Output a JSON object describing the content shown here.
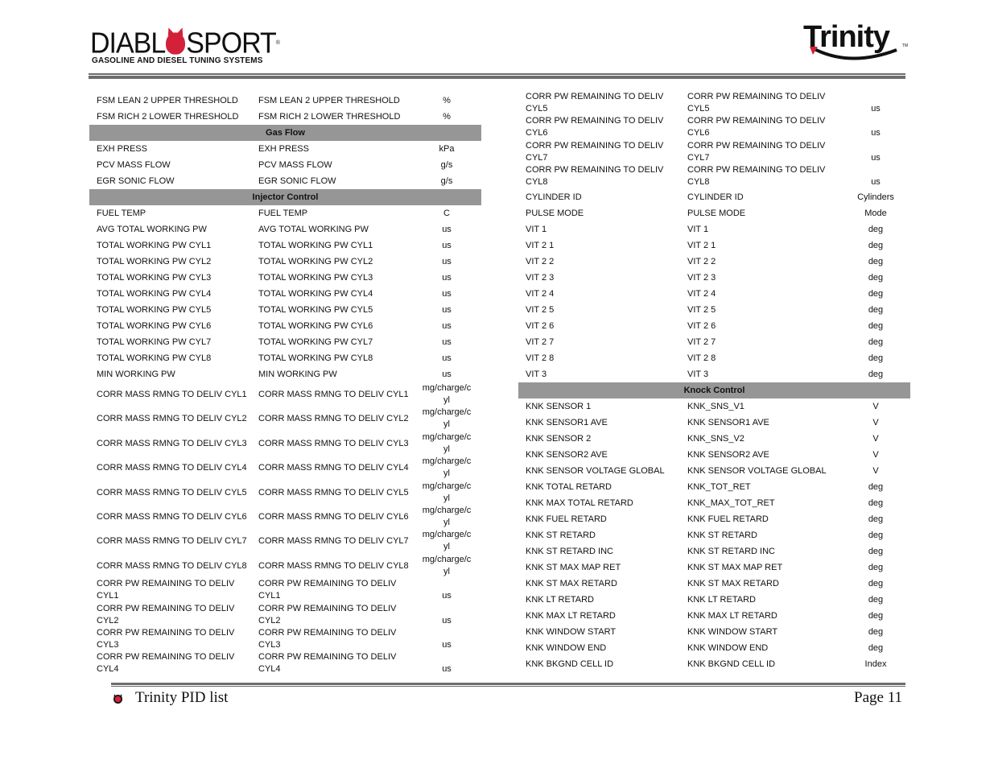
{
  "header": {
    "brand_left": "DIABLOSPORT",
    "brand_left_tagline": "GASOLINE AND DIESEL TUNING SYSTEMS",
    "brand_right": "Trinity",
    "brand_right_tm": "TM"
  },
  "colors": {
    "section_bg": "#969696",
    "rule": "#6d6d6d",
    "accent_red": "#d4213a"
  },
  "left_column": [
    {
      "type": "row",
      "name": "FSM LEAN 2 UPPER THRESHOLD",
      "pid": "FSM LEAN 2 UPPER THRESHOLD",
      "unit": "%"
    },
    {
      "type": "row",
      "name": "FSM RICH 2 LOWER THRESHOLD",
      "pid": "FSM RICH 2 LOWER THRESHOLD",
      "unit": "%"
    },
    {
      "type": "section",
      "title": "Gas Flow"
    },
    {
      "type": "row",
      "name": "EXH PRESS",
      "pid": "EXH PRESS",
      "unit": "kPa"
    },
    {
      "type": "row",
      "name": "PCV MASS FLOW",
      "pid": "PCV MASS FLOW",
      "unit": "g/s"
    },
    {
      "type": "row",
      "name": "EGR SONIC FLOW",
      "pid": "EGR SONIC FLOW",
      "unit": "g/s"
    },
    {
      "type": "section",
      "title": "Injector Control"
    },
    {
      "type": "row",
      "name": "FUEL TEMP",
      "pid": "FUEL TEMP",
      "unit": "C"
    },
    {
      "type": "row",
      "name": "AVG TOTAL WORKING PW",
      "pid": "AVG TOTAL WORKING PW",
      "unit": "us"
    },
    {
      "type": "row",
      "name": "TOTAL WORKING PW CYL1",
      "pid": "TOTAL WORKING PW CYL1",
      "unit": "us"
    },
    {
      "type": "row",
      "name": "TOTAL WORKING PW CYL2",
      "pid": "TOTAL WORKING PW CYL2",
      "unit": "us"
    },
    {
      "type": "row",
      "name": "TOTAL WORKING PW CYL3",
      "pid": "TOTAL WORKING PW CYL3",
      "unit": "us"
    },
    {
      "type": "row",
      "name": "TOTAL WORKING PW CYL4",
      "pid": "TOTAL WORKING PW CYL4",
      "unit": "us"
    },
    {
      "type": "row",
      "name": "TOTAL WORKING PW CYL5",
      "pid": "TOTAL WORKING PW CYL5",
      "unit": "us"
    },
    {
      "type": "row",
      "name": "TOTAL WORKING PW CYL6",
      "pid": "TOTAL WORKING PW CYL6",
      "unit": "us"
    },
    {
      "type": "row",
      "name": "TOTAL WORKING PW CYL7",
      "pid": "TOTAL WORKING PW CYL7",
      "unit": "us"
    },
    {
      "type": "row",
      "name": "TOTAL WORKING PW CYL8",
      "pid": "TOTAL WORKING PW CYL8",
      "unit": "us"
    },
    {
      "type": "row",
      "name": "MIN WORKING PW",
      "pid": "MIN WORKING PW",
      "unit": "us"
    },
    {
      "type": "unit2",
      "name": "CORR MASS RMNG TO DELIV CYL1",
      "pid": "CORR MASS RMNG TO DELIV CYL1",
      "unit": "mg/charge/c yl"
    },
    {
      "type": "unit2",
      "name": "CORR MASS RMNG TO DELIV CYL2",
      "pid": "CORR MASS RMNG TO DELIV CYL2",
      "unit": "mg/charge/c yl"
    },
    {
      "type": "unit2",
      "name": "CORR MASS RMNG TO DELIV CYL3",
      "pid": "CORR MASS RMNG TO DELIV CYL3",
      "unit": "mg/charge/c yl"
    },
    {
      "type": "unit2",
      "name": "CORR MASS RMNG TO DELIV CYL4",
      "pid": "CORR MASS RMNG TO DELIV CYL4",
      "unit": "mg/charge/c yl"
    },
    {
      "type": "unit2",
      "name": "CORR MASS RMNG TO DELIV CYL5",
      "pid": "CORR MASS RMNG TO DELIV CYL5",
      "unit": "mg/charge/c yl"
    },
    {
      "type": "unit2",
      "name": "CORR MASS RMNG TO DELIV CYL6",
      "pid": "CORR MASS RMNG TO DELIV CYL6",
      "unit": "mg/charge/c yl"
    },
    {
      "type": "unit2",
      "name": "CORR MASS RMNG TO DELIV CYL7",
      "pid": "CORR MASS RMNG TO DELIV CYL7",
      "unit": "mg/charge/c yl"
    },
    {
      "type": "unit2",
      "name": "CORR MASS RMNG TO DELIV CYL8",
      "pid": "CORR MASS RMNG TO DELIV CYL8",
      "unit": "mg/charge/c yl"
    },
    {
      "type": "two",
      "name": "CORR PW REMAINING TO DELIV CYL1",
      "pid": "CORR PW REMAINING TO DELIV CYL1",
      "unit": "us"
    },
    {
      "type": "two",
      "name": "CORR PW REMAINING TO DELIV CYL2",
      "pid": "CORR PW REMAINING TO DELIV CYL2",
      "unit": "us"
    },
    {
      "type": "two",
      "name": "CORR PW REMAINING TO DELIV CYL3",
      "pid": "CORR PW REMAINING TO DELIV CYL3",
      "unit": "us"
    },
    {
      "type": "two",
      "name": "CORR PW REMAINING TO DELIV CYL4",
      "pid": "CORR PW REMAINING TO DELIV CYL4",
      "unit": "us"
    }
  ],
  "right_column": [
    {
      "type": "two",
      "name": "CORR PW REMAINING TO DELIV CYL5",
      "pid": "CORR PW REMAINING TO DELIV CYL5",
      "unit": "us"
    },
    {
      "type": "two",
      "name": "CORR PW REMAINING TO DELIV CYL6",
      "pid": "CORR PW REMAINING TO DELIV CYL6",
      "unit": "us"
    },
    {
      "type": "two",
      "name": "CORR PW REMAINING TO DELIV CYL7",
      "pid": "CORR PW REMAINING TO DELIV CYL7",
      "unit": "us"
    },
    {
      "type": "two",
      "name": "CORR PW REMAINING TO DELIV CYL8",
      "pid": "CORR PW REMAINING TO DELIV CYL8",
      "unit": "us"
    },
    {
      "type": "row",
      "name": "CYLINDER ID",
      "pid": "CYLINDER ID",
      "unit": "Cylinders"
    },
    {
      "type": "row",
      "name": "PULSE MODE",
      "pid": "PULSE MODE",
      "unit": "Mode"
    },
    {
      "type": "row",
      "name": "VIT 1",
      "pid": "VIT 1",
      "unit": "deg"
    },
    {
      "type": "row",
      "name": "VIT 2 1",
      "pid": "VIT 2 1",
      "unit": "deg"
    },
    {
      "type": "row",
      "name": "VIT 2 2",
      "pid": "VIT 2 2",
      "unit": "deg"
    },
    {
      "type": "row",
      "name": "VIT 2 3",
      "pid": "VIT 2 3",
      "unit": "deg"
    },
    {
      "type": "row",
      "name": "VIT 2 4",
      "pid": "VIT 2 4",
      "unit": "deg"
    },
    {
      "type": "row",
      "name": "VIT 2 5",
      "pid": "VIT 2 5",
      "unit": "deg"
    },
    {
      "type": "row",
      "name": "VIT 2 6",
      "pid": "VIT 2 6",
      "unit": "deg"
    },
    {
      "type": "row",
      "name": "VIT 2 7",
      "pid": "VIT 2 7",
      "unit": "deg"
    },
    {
      "type": "row",
      "name": "VIT 2 8",
      "pid": "VIT 2 8",
      "unit": "deg"
    },
    {
      "type": "row",
      "name": "VIT 3",
      "pid": "VIT 3",
      "unit": "deg"
    },
    {
      "type": "section",
      "title": "Knock Control"
    },
    {
      "type": "row",
      "name": "KNK SENSOR 1",
      "pid": "KNK_SNS_V1",
      "unit": "V"
    },
    {
      "type": "row",
      "name": "KNK SENSOR1 AVE",
      "pid": "KNK SENSOR1 AVE",
      "unit": "V"
    },
    {
      "type": "row",
      "name": "KNK SENSOR 2",
      "pid": "KNK_SNS_V2",
      "unit": "V"
    },
    {
      "type": "row",
      "name": "KNK SENSOR2 AVE",
      "pid": "KNK SENSOR2 AVE",
      "unit": "V"
    },
    {
      "type": "row",
      "name": "KNK SENSOR VOLTAGE GLOBAL",
      "pid": "KNK SENSOR VOLTAGE GLOBAL",
      "unit": "V"
    },
    {
      "type": "row",
      "name": "KNK TOTAL RETARD",
      "pid": "KNK_TOT_RET",
      "unit": "deg"
    },
    {
      "type": "row",
      "name": "KNK MAX TOTAL RETARD",
      "pid": "KNK_MAX_TOT_RET",
      "unit": "deg"
    },
    {
      "type": "row",
      "name": "KNK FUEL RETARD",
      "pid": "KNK FUEL RETARD",
      "unit": "deg"
    },
    {
      "type": "row",
      "name": "KNK ST RETARD",
      "pid": "KNK ST RETARD",
      "unit": "deg"
    },
    {
      "type": "row",
      "name": "KNK ST RETARD INC",
      "pid": "KNK ST RETARD INC",
      "unit": "deg"
    },
    {
      "type": "row",
      "name": "KNK ST MAX MAP RET",
      "pid": "KNK ST MAX MAP RET",
      "unit": "deg"
    },
    {
      "type": "row",
      "name": "KNK ST MAX RETARD",
      "pid": "KNK ST MAX RETARD",
      "unit": "deg"
    },
    {
      "type": "row",
      "name": "KNK LT RETARD",
      "pid": "KNK LT RETARD",
      "unit": "deg"
    },
    {
      "type": "row",
      "name": "KNK MAX LT RETARD",
      "pid": "KNK MAX LT RETARD",
      "unit": "deg"
    },
    {
      "type": "row",
      "name": "KNK WINDOW START",
      "pid": "KNK WINDOW START",
      "unit": "deg"
    },
    {
      "type": "row",
      "name": "KNK WINDOW END",
      "pid": "KNK WINDOW END",
      "unit": "deg"
    },
    {
      "type": "row",
      "name": "KNK BKGND CELL ID",
      "pid": "KNK BKGND CELL ID",
      "unit": "Index"
    }
  ],
  "footer": {
    "title": "Trinity PID list",
    "page": "Page 11"
  }
}
